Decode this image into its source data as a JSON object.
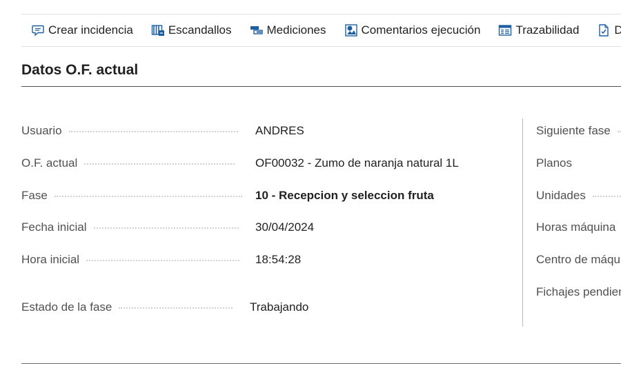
{
  "toolbar": {
    "items": [
      {
        "label": "Crear incidencia",
        "icon": "comment-icon"
      },
      {
        "label": "Escandallos",
        "icon": "bill-of-materials-icon"
      },
      {
        "label": "Mediciones",
        "icon": "measurements-icon"
      },
      {
        "label": "Comentarios ejecución",
        "icon": "execution-comments-icon"
      },
      {
        "label": "Trazabilidad",
        "icon": "traceability-icon"
      },
      {
        "label": "D",
        "icon": "document-check-icon"
      }
    ]
  },
  "section": {
    "title": "Datos O.F. actual"
  },
  "left_fields": [
    {
      "label": "Usuario",
      "value": "ANDRES"
    },
    {
      "label": "O.F. actual",
      "value": "OF00032 - Zumo de naranja natural 1L"
    },
    {
      "label": "Fase",
      "value": "10 - Recepcion y seleccion fruta"
    },
    {
      "label": "Fecha inicial",
      "value": "30/04/2024"
    },
    {
      "label": "Hora inicial",
      "value": "18:54:28"
    },
    {
      "label": "Estado de la fase",
      "value": "Trabajando"
    }
  ],
  "right_fields": [
    {
      "label": "Siguiente fase"
    },
    {
      "label": "Planos"
    },
    {
      "label": "Unidades"
    },
    {
      "label": "Horas máquina"
    },
    {
      "label": "Centro de máquina"
    },
    {
      "label": "Fichajes pendientes"
    }
  ],
  "colors": {
    "icon_blue": "#1f5fa0",
    "text": "#212121",
    "label": "#505050"
  }
}
